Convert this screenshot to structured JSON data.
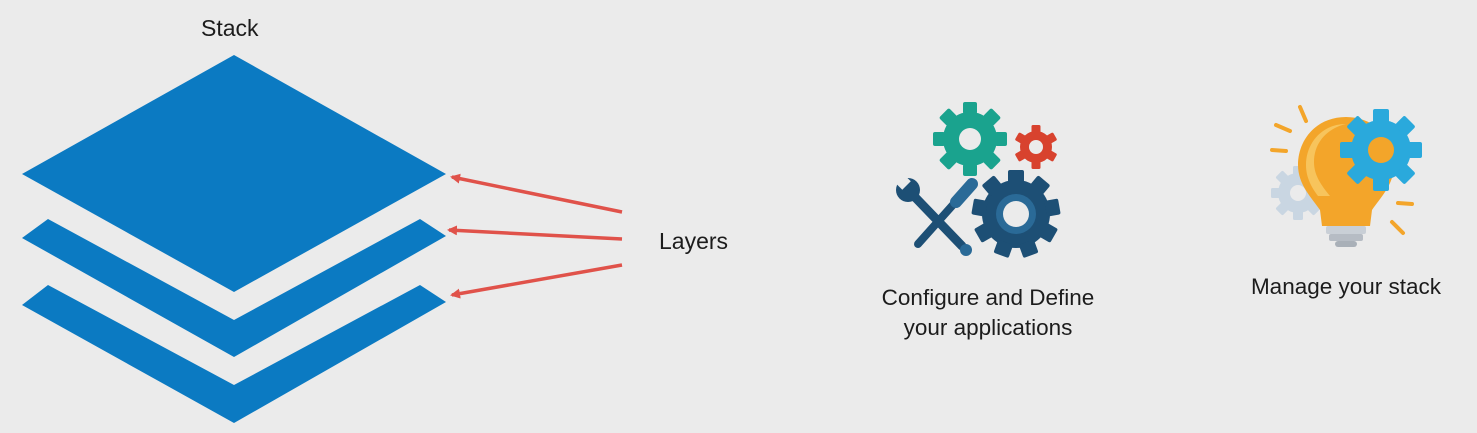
{
  "stack": {
    "title": "Stack"
  },
  "layers": {
    "label": "Layers"
  },
  "features": [
    {
      "icon": "gears-tools-icon",
      "caption_line1": "Configure and Define",
      "caption_line2": "your applications"
    },
    {
      "icon": "lightbulb-gear-icon",
      "caption": "Manage your stack"
    }
  ],
  "colors": {
    "background": "#ebebeb",
    "layer_blue": "#0b7ac2",
    "arrow_red": "#e0524a",
    "gear_teal": "#1aa38e",
    "gear_red": "#d8422e",
    "gear_navy": "#1d4f75",
    "bulb_orange": "#f3a52a",
    "gear_cyan": "#2aa9dc"
  }
}
